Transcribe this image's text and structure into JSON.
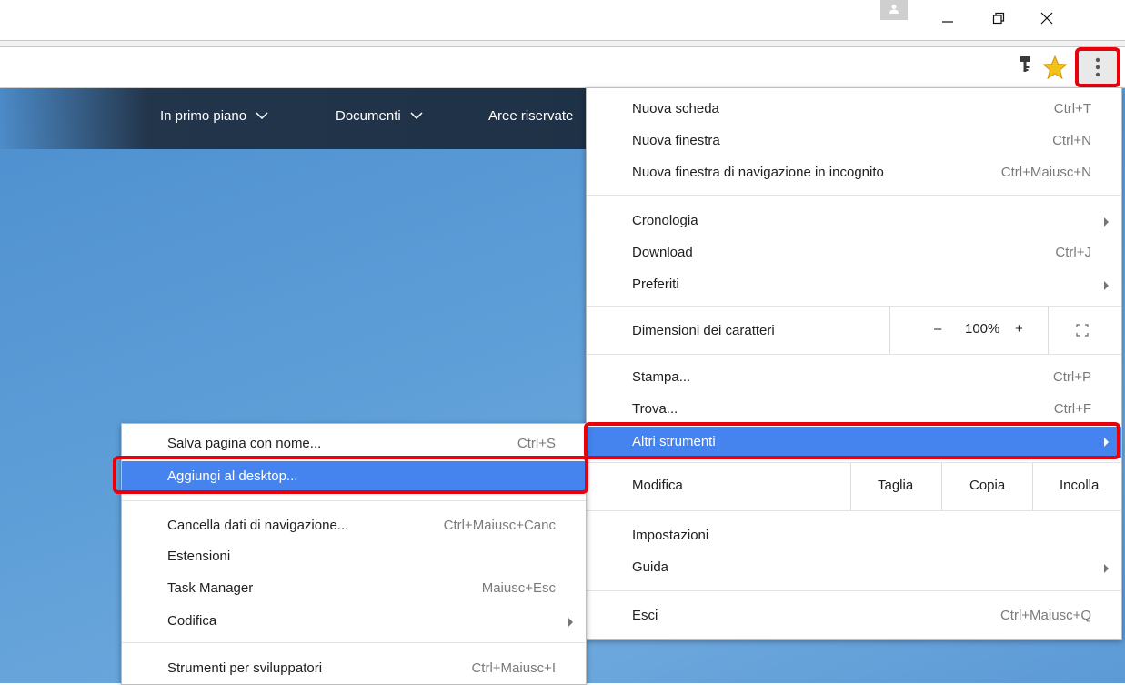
{
  "window": {
    "profile_icon": "person-icon",
    "minimize_icon": "minimize-icon",
    "restore_icon": "restore-icon",
    "close_icon": "close-icon"
  },
  "toolbar": {
    "icons": [
      "key-icon",
      "star-icon",
      "kebab-menu-icon"
    ],
    "accent_star": "#f2c218",
    "highlight_outline": "#e8000b"
  },
  "site_nav": {
    "items": [
      {
        "label": "In primo piano"
      },
      {
        "label": "Documenti"
      },
      {
        "label": "Aree riservate"
      }
    ]
  },
  "main_menu": {
    "new_tab": {
      "label": "Nuova scheda",
      "shortcut": "Ctrl+T"
    },
    "new_window": {
      "label": "Nuova finestra",
      "shortcut": "Ctrl+N"
    },
    "incognito": {
      "label": "Nuova finestra di navigazione in incognito",
      "shortcut": "Ctrl+Maiusc+N"
    },
    "history": {
      "label": "Cronologia"
    },
    "downloads": {
      "label": "Download",
      "shortcut": "Ctrl+J"
    },
    "bookmarks": {
      "label": "Preferiti"
    },
    "zoom": {
      "label": "Dimensioni dei caratteri",
      "minus": "–",
      "value": "100%",
      "plus": "+"
    },
    "print": {
      "label": "Stampa...",
      "shortcut": "Ctrl+P"
    },
    "find": {
      "label": "Trova...",
      "shortcut": "Ctrl+F"
    },
    "more_tools": {
      "label": "Altri strumenti"
    },
    "edit": {
      "label": "Modifica",
      "cut": "Taglia",
      "copy": "Copia",
      "paste": "Incolla"
    },
    "settings": {
      "label": "Impostazioni"
    },
    "help": {
      "label": "Guida"
    },
    "exit": {
      "label": "Esci",
      "shortcut": "Ctrl+Maiusc+Q"
    },
    "highlight_color": "#4584ee"
  },
  "sub_menu": {
    "save_page": {
      "label": "Salva pagina con nome...",
      "shortcut": "Ctrl+S"
    },
    "add_to_desktop": {
      "label": "Aggiungi al desktop..."
    },
    "clear_data": {
      "label": "Cancella dati di navigazione...",
      "shortcut": "Ctrl+Maiusc+Canc"
    },
    "extensions": {
      "label": "Estensioni"
    },
    "task_manager": {
      "label": "Task Manager",
      "shortcut": "Maiusc+Esc"
    },
    "encoding": {
      "label": "Codifica"
    },
    "dev_tools": {
      "label": "Strumenti per sviluppatori",
      "shortcut": "Ctrl+Maiusc+I"
    }
  }
}
